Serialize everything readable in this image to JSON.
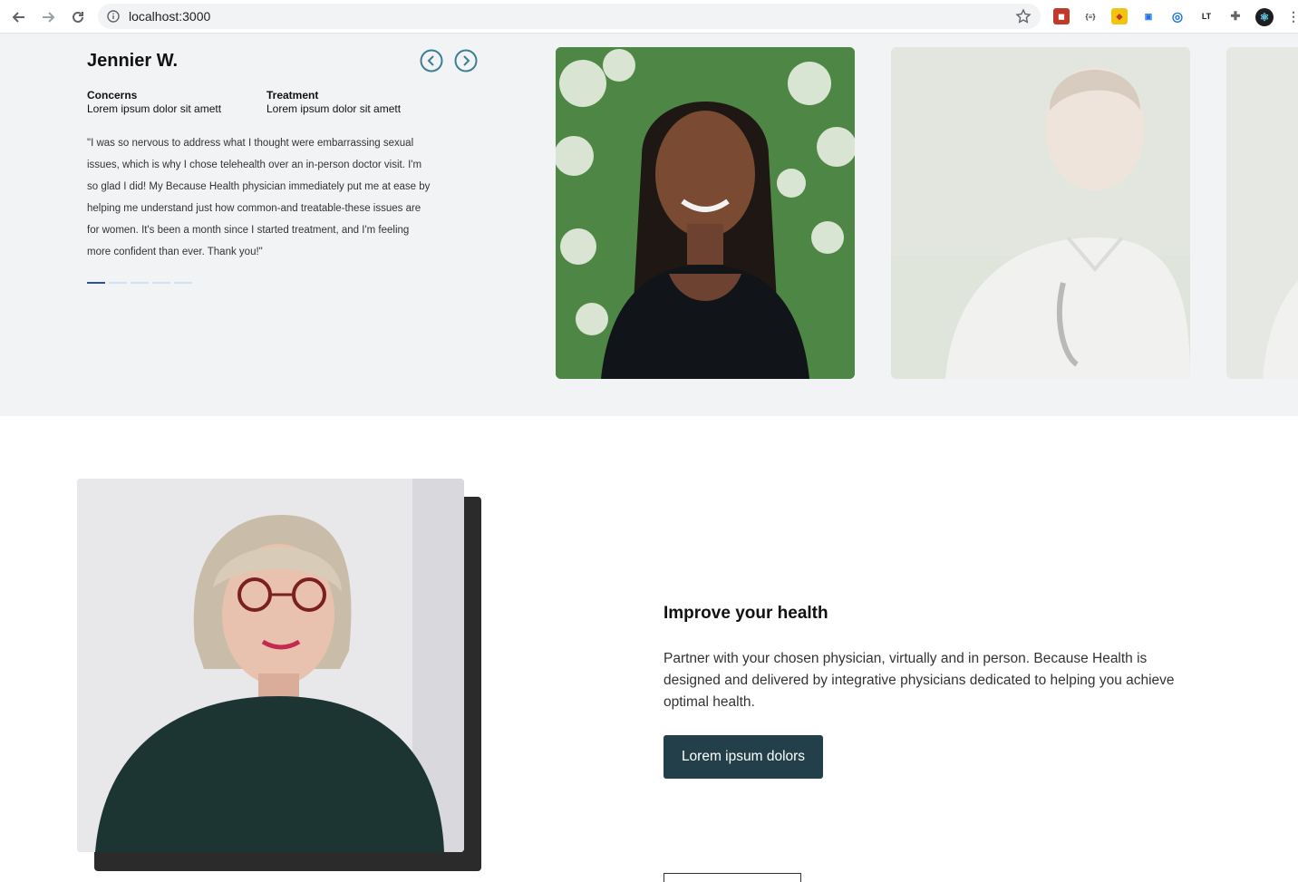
{
  "browser": {
    "url": "localhost:3000"
  },
  "testimonial": {
    "name": "Jennier W.",
    "concerns_label": "Concerns",
    "concerns_value": "Lorem ipsum dolor sit amett",
    "treatment_label": "Treatment",
    "treatment_value": "Lorem ipsum dolor sit amett",
    "quote": "\"I was so nervous to address what I thought were embarrassing sexual issues, which is why I chose telehealth over an in-person doctor visit. I'm so glad I did! My Because Health physician immediately put me at ease by helping me understand just how common-and treatable-these issues are for women. It's been a month since I started treatment, and I'm feeling more confident than ever. Thank you!\"",
    "slide_count": 5,
    "active_slide": 1
  },
  "health": {
    "title": "Improve your health",
    "body": "Partner with your chosen physician, virtually and in person. Because Health is designed and delivered by integrative physicians dedicated to helping you achieve optimal health.",
    "button_label": "Lorem ipsum dolors"
  },
  "colors": {
    "section_bg": "#f2f3f5",
    "arrow": "#3a7f96",
    "dot_active": "#2a4fa3",
    "dot_inactive": "#cfe3f5",
    "button_bg": "#233f4a"
  }
}
